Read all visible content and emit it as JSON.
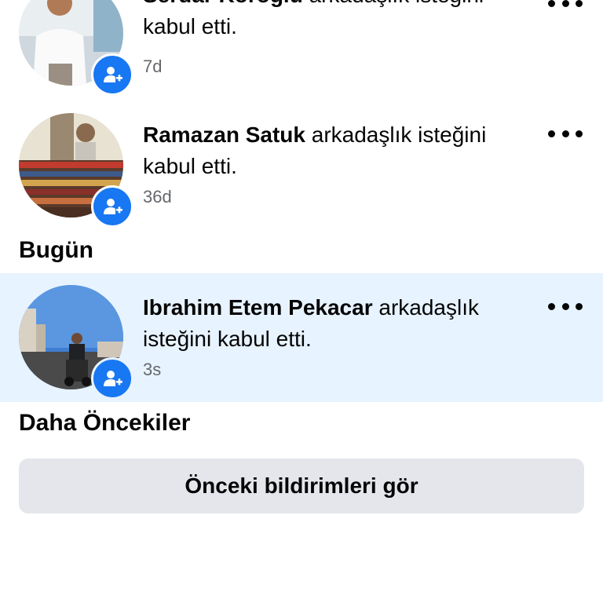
{
  "notifications_earlier_top": [
    {
      "name": "Serdar Koroglu",
      "action": "arkadaşlık isteğini kabul etti.",
      "time": "7d",
      "avatar_icon": "person-photo",
      "badge_icon": "add-friend-icon"
    },
    {
      "name": "Ramazan Satuk",
      "action": "arkadaşlık isteğini kabul etti.",
      "time": "36d",
      "avatar_icon": "person-photo",
      "badge_icon": "add-friend-icon"
    }
  ],
  "sections": {
    "today": "Bugün",
    "earlier": "Daha Öncekiler"
  },
  "notifications_today": [
    {
      "name": "Ibrahim Etem Pekacar",
      "action": "arkadaşlık isteğini kabul etti.",
      "time": "3s",
      "unread": true,
      "avatar_icon": "person-photo",
      "badge_icon": "add-friend-icon"
    }
  ],
  "buttons": {
    "see_previous": "Önceki bildirimleri gör"
  },
  "colors": {
    "accent": "#1877f2",
    "unread_bg": "#e7f3ff",
    "secondary_text": "#65676b",
    "button_bg": "#e4e6eb"
  }
}
